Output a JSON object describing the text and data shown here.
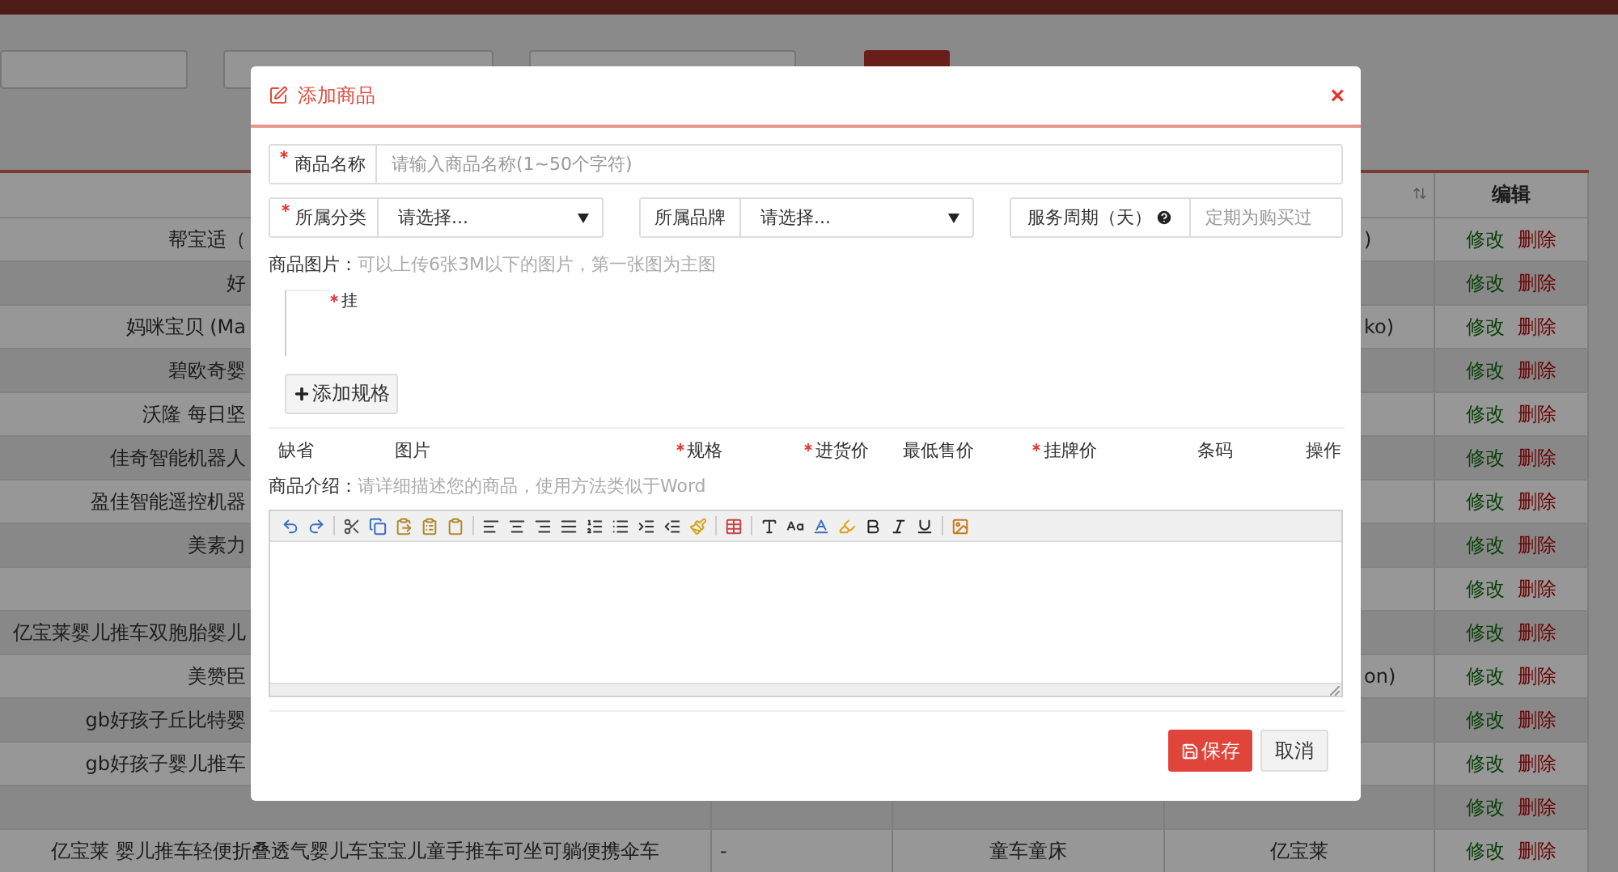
{
  "page": {
    "table": {
      "edit_header": "编辑",
      "rows": [
        {
          "name": "帮宝适（",
          "column_2": "",
          "column_3": "",
          "column_4": ")",
          "actions": [
            "修改",
            "删除"
          ]
        },
        {
          "name": "好",
          "column_2": "",
          "column_3": "",
          "column_4": "",
          "actions": [
            "修改",
            "删除"
          ]
        },
        {
          "name": "妈咪宝贝 (Ma",
          "column_2": "",
          "column_3": "",
          "column_4": "ko)",
          "actions": [
            "修改",
            "删除"
          ]
        },
        {
          "name": "碧欧奇婴",
          "column_2": "",
          "column_3": "",
          "column_4": "",
          "actions": [
            "修改",
            "删除"
          ]
        },
        {
          "name": "沃隆 每日坚",
          "column_2": "",
          "column_3": "",
          "column_4": "",
          "actions": [
            "修改",
            "删除"
          ]
        },
        {
          "name": "佳奇智能机器人",
          "column_2": "",
          "column_3": "",
          "column_4": "",
          "actions": [
            "修改",
            "删除"
          ]
        },
        {
          "name": "盈佳智能遥控机器",
          "column_2": "",
          "column_3": "",
          "column_4": "",
          "actions": [
            "修改",
            "删除"
          ]
        },
        {
          "name": "美素力",
          "column_2": "",
          "column_3": "",
          "column_4": "",
          "actions": [
            "修改",
            "删除"
          ]
        },
        {
          "name": "",
          "column_2": "",
          "column_3": "",
          "column_4": "",
          "actions": [
            "修改",
            "删除"
          ]
        },
        {
          "name": "亿宝莱婴儿推车双胞胎婴儿",
          "column_2": "",
          "column_3": "",
          "column_4": "",
          "actions": [
            "修改",
            "删除"
          ]
        },
        {
          "name": "美赞臣",
          "column_2": "",
          "column_3": "",
          "column_4": "on)",
          "actions": [
            "修改",
            "删除"
          ]
        },
        {
          "name": "gb好孩子丘比特婴",
          "column_2": "",
          "column_3": "",
          "column_4": "",
          "actions": [
            "修改",
            "删除"
          ]
        },
        {
          "name": "gb好孩子婴儿推车",
          "column_2": "",
          "column_3": "",
          "column_4": "",
          "actions": [
            "修改",
            "删除"
          ]
        },
        {
          "name": "",
          "column_2": "",
          "column_3": "",
          "column_4": "",
          "actions": [
            "修改",
            "删除"
          ]
        },
        {
          "name": "亿宝莱 婴儿推车轻便折叠透气婴儿车宝宝儿童手推车可坐可躺便携伞车",
          "column_2": "-",
          "column_3": "童车童床",
          "column_4": "亿宝莱",
          "actions": [
            "修改",
            "删除"
          ]
        }
      ]
    }
  },
  "dialog": {
    "title": "添加商品",
    "close": "×",
    "name_field": {
      "label": "商品名称",
      "required": true,
      "placeholder": "请输入商品名称(1~50个字符)"
    },
    "category": {
      "label": "所属分类",
      "required": true,
      "value": "请选择..."
    },
    "brand": {
      "label": "所属品牌",
      "required": false,
      "value": "请选择..."
    },
    "service_period": {
      "label": "服务周期（天）",
      "placeholder": "定期为购买过"
    },
    "images": {
      "label": "商品图片：",
      "hint": "可以上传6张3M以下的图片，第一张图为主图",
      "upload_text": "挂",
      "upload_required": true
    },
    "add_spec_button": "添加规格",
    "spec_columns": [
      {
        "label": "缺省",
        "required": false
      },
      {
        "label": "图片",
        "required": false
      },
      {
        "label": "规格",
        "required": true
      },
      {
        "label": "进货价",
        "required": true
      },
      {
        "label": "最低售价",
        "required": false
      },
      {
        "label": "挂牌价",
        "required": true
      },
      {
        "label": "条码",
        "required": false
      },
      {
        "label": "操作",
        "required": false
      }
    ],
    "intro": {
      "label": "商品介绍：",
      "hint": "请详细描述您的商品，使用方法类似于Word"
    },
    "buttons": {
      "save": "保存",
      "cancel": "取消"
    }
  }
}
